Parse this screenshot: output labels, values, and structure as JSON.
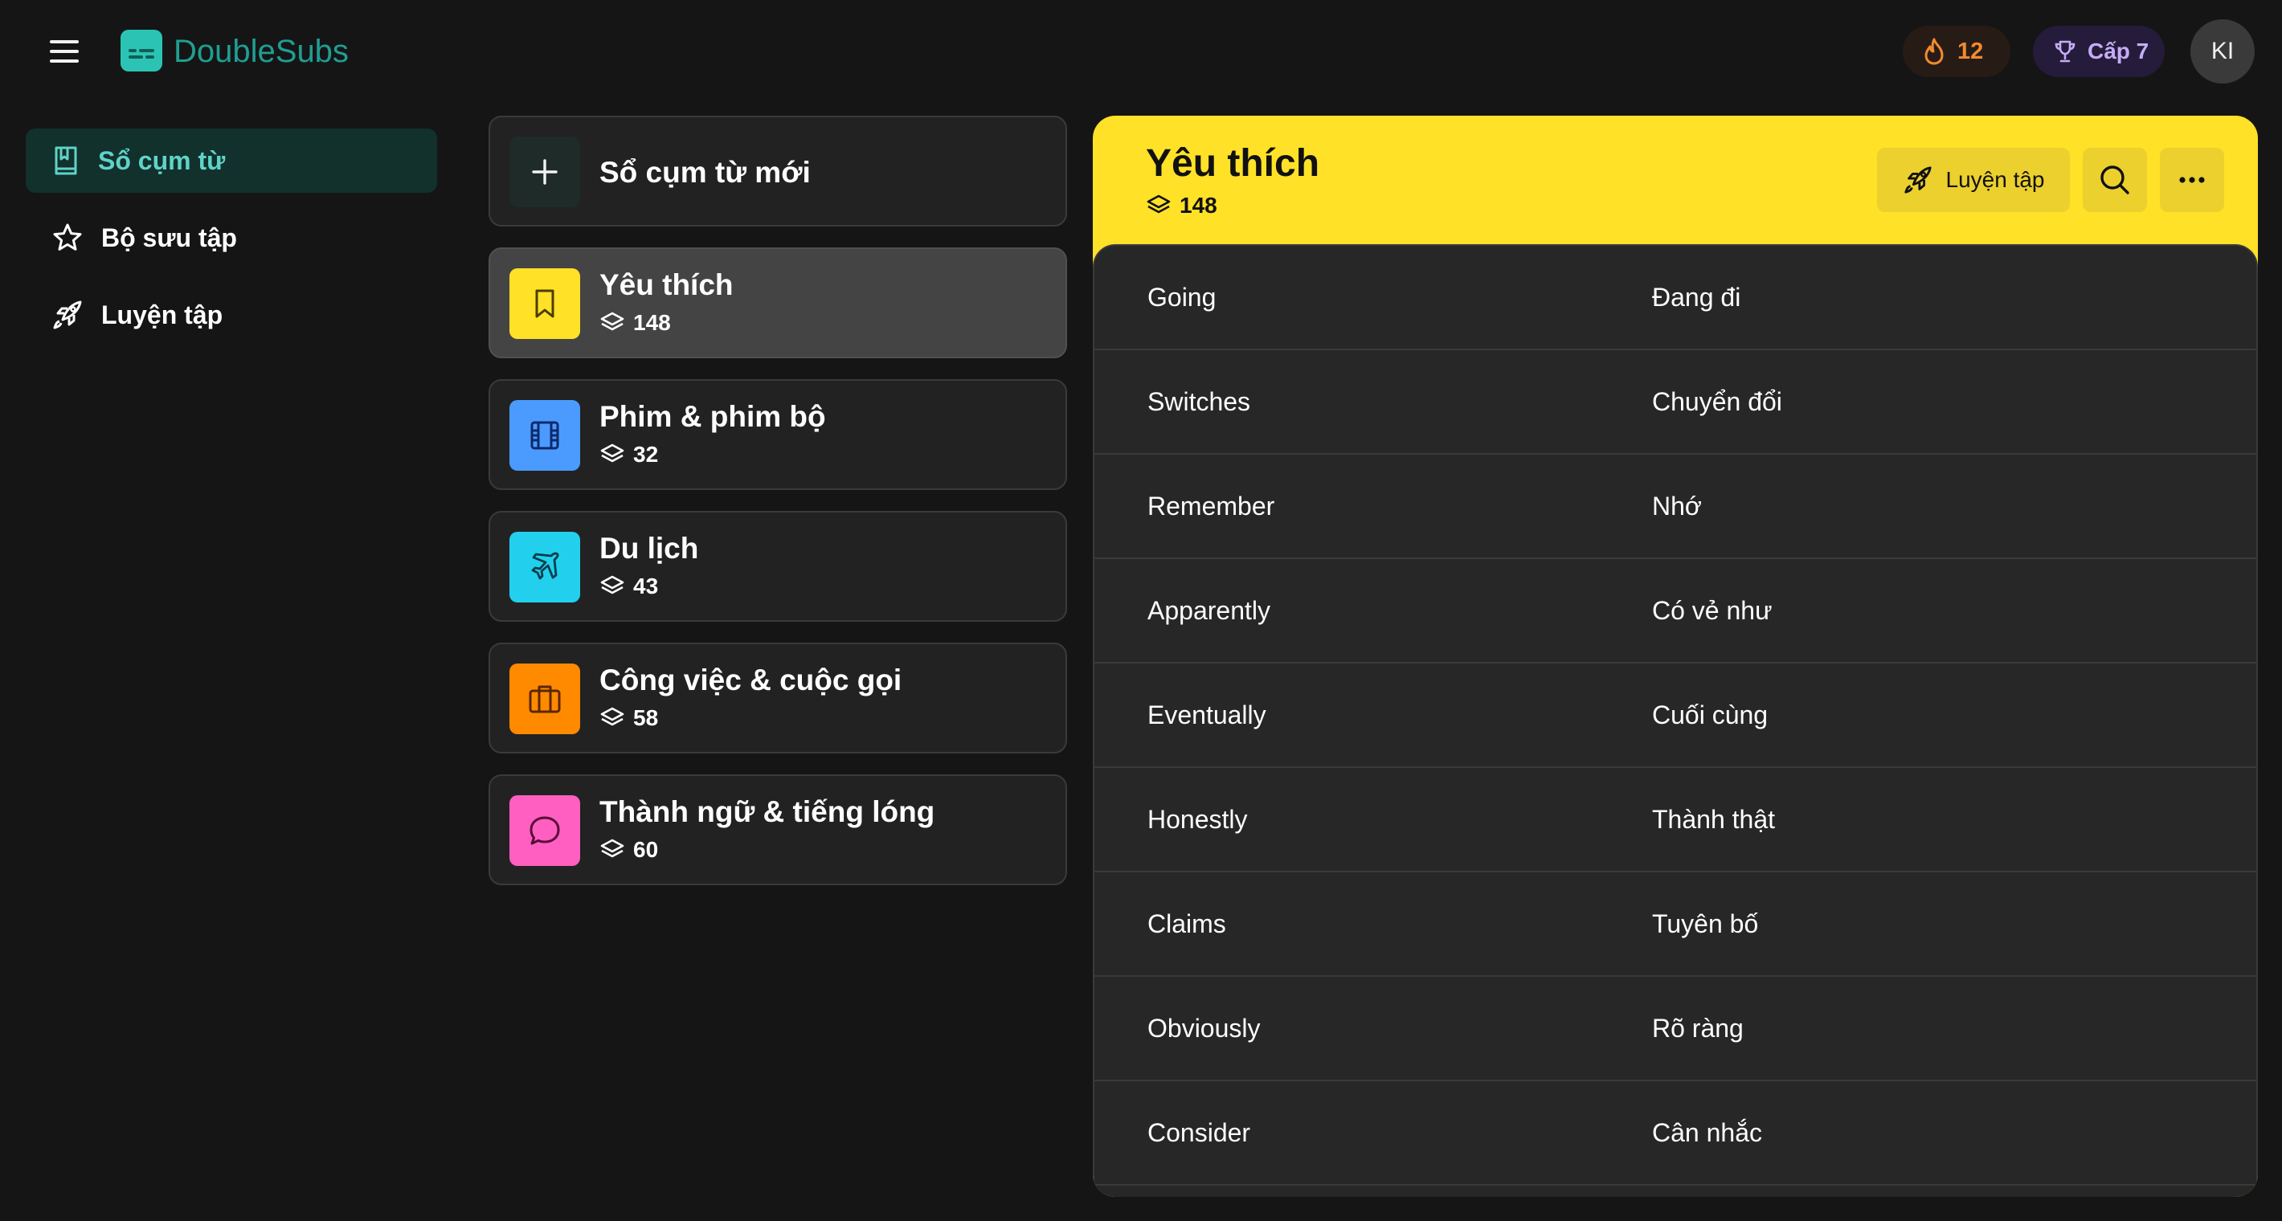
{
  "header": {
    "app_name": "DoubleSubs",
    "streak": "12",
    "level": "Cấp 7",
    "avatar_initials": "KI",
    "icons": {
      "menu": "menu-icon",
      "logo": "subtitles-logo",
      "streak": "flame-icon",
      "level": "trophy-icon"
    },
    "colors": {
      "brand": "#1f9e93",
      "streak": "#f28a2e",
      "level": "#c4adf5"
    }
  },
  "sidebar": {
    "items": [
      {
        "label": "Sổ cụm từ",
        "icon": "phrasebook-icon",
        "active": true
      },
      {
        "label": "Bộ sưu tập",
        "icon": "star-icon",
        "active": false
      },
      {
        "label": "Luyện tập",
        "icon": "rocket-icon",
        "active": false
      }
    ]
  },
  "phrasebooks": {
    "new_label": "Sổ cụm từ mới",
    "items": [
      {
        "title": "Yêu thích",
        "count": "148",
        "icon": "bookmark-icon",
        "color": "#ffe127",
        "selected": true
      },
      {
        "title": "Phim & phim bộ",
        "count": "32",
        "icon": "film-icon",
        "color": "#4b9bff",
        "selected": false
      },
      {
        "title": "Du lịch",
        "count": "43",
        "icon": "plane-icon",
        "color": "#22d0ee",
        "selected": false
      },
      {
        "title": "Công việc & cuộc gọi",
        "count": "58",
        "icon": "briefcase-icon",
        "color": "#ff8a00",
        "selected": false
      },
      {
        "title": "Thành ngữ & tiếng lóng",
        "count": "60",
        "icon": "chat-bubble-icon",
        "color": "#ff5fc0",
        "selected": false
      }
    ]
  },
  "detail": {
    "title": "Yêu thích",
    "count": "148",
    "practice_label": "Luyện tập",
    "accent": "#ffe127",
    "words": [
      {
        "term": "Going",
        "meaning": "Đang đi"
      },
      {
        "term": "Switches",
        "meaning": "Chuyển đổi"
      },
      {
        "term": "Remember",
        "meaning": "Nhớ"
      },
      {
        "term": "Apparently",
        "meaning": "Có vẻ như"
      },
      {
        "term": "Eventually",
        "meaning": "Cuối cùng"
      },
      {
        "term": "Honestly",
        "meaning": "Thành thật"
      },
      {
        "term": "Claims",
        "meaning": "Tuyên bố"
      },
      {
        "term": "Obviously",
        "meaning": "Rõ ràng"
      },
      {
        "term": "Consider",
        "meaning": "Cân nhắc"
      }
    ]
  }
}
